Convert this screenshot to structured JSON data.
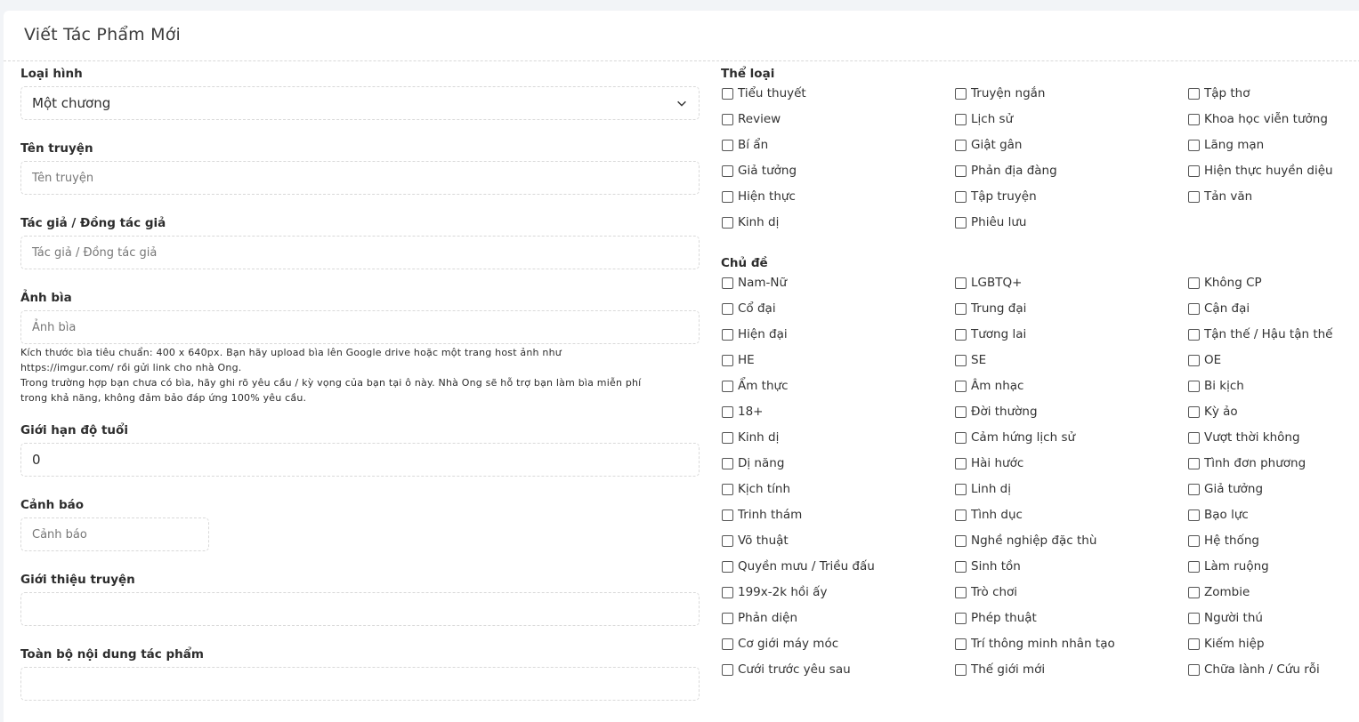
{
  "page": {
    "title": "Viết Tác Phẩm Mới"
  },
  "form": {
    "type": {
      "label": "Loại hình",
      "value": "Một chương"
    },
    "title": {
      "label": "Tên truyện",
      "placeholder": "Tên truyện"
    },
    "author": {
      "label": "Tác giả / Đồng tác giả",
      "placeholder": "Tác giả / Đồng tác giả"
    },
    "cover": {
      "label": "Ảnh bìa",
      "placeholder": "Ảnh bìa",
      "help": [
        "Kích thước bìa tiêu chuẩn: 400 x 640px. Bạn hãy upload bìa lên Google drive hoặc một trang host ảnh như",
        "https://imgur.com/ rồi gửi link cho nhà Ong.",
        "Trong trường hợp bạn chưa có bìa, hãy ghi rõ yêu cầu / kỳ vọng của bạn tại ô này. Nhà Ong sẽ hỗ trợ bạn làm bìa miễn phí",
        "trong khả năng, không đảm bảo đáp ứng 100% yêu cầu."
      ]
    },
    "age": {
      "label": "Giới hạn độ tuổi",
      "value": "0"
    },
    "warning": {
      "label": "Cảnh báo",
      "placeholder": "Cảnh báo"
    },
    "intro": {
      "label": "Giới thiệu truyện",
      "placeholder": ""
    },
    "content": {
      "label": "Toàn bộ nội dung tác phẩm",
      "placeholder": ""
    }
  },
  "genres": {
    "title": "Thể loại",
    "items": [
      "Tiểu thuyết",
      "Truyện ngắn",
      "Tập thơ",
      "Review",
      "Lịch sử",
      "Khoa học viễn tưởng",
      "Bí ẩn",
      "Giật gân",
      "Lãng mạn",
      "Giả tưởng",
      "Phản địa đàng",
      "Hiện thực huyền diệu",
      "Hiện thực",
      "Tập truyện",
      "Tản văn",
      "Kinh dị",
      "Phiêu lưu"
    ]
  },
  "topics": {
    "title": "Chủ đề",
    "items": [
      "Nam-Nữ",
      "LGBTQ+",
      "Không CP",
      "Cổ đại",
      "Trung đại",
      "Cận đại",
      "Hiện đại",
      "Tương lai",
      "Tận thế / Hậu tận thế",
      "HE",
      "SE",
      "OE",
      "Ẩm thực",
      "Âm nhạc",
      "Bi kịch",
      "18+",
      "Đời thường",
      "Kỳ ảo",
      "Kinh dị",
      "Cảm hứng lịch sử",
      "Vượt thời không",
      "Dị năng",
      "Hài hước",
      "Tình đơn phương",
      "Kịch tính",
      "Linh dị",
      "Giả tưởng",
      "Trinh thám",
      "Tình dục",
      "Bạo lực",
      "Võ thuật",
      "Nghề nghiệp đặc thù",
      "Hệ thống",
      "Quyền mưu / Triều đấu",
      "Sinh tồn",
      "Làm ruộng",
      "199x-2k hồi ấy",
      "Trò chơi",
      "Zombie",
      "Phản diện",
      "Phép thuật",
      "Người thú",
      "Cơ giới máy móc",
      "Trí thông minh nhân tạo",
      "Kiếm hiệp",
      "Cưới trước yêu sau",
      "Thế giới mới",
      "Chữa lành / Cứu rỗi"
    ]
  }
}
